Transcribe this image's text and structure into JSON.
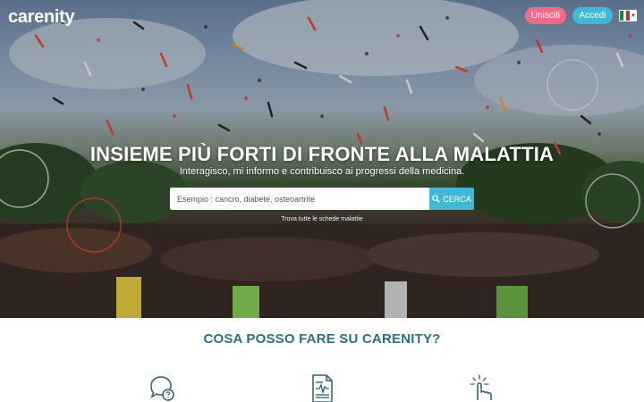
{
  "header": {
    "logo_text": "carenity",
    "join_label": "Unisciti",
    "login_label": "Accedi",
    "language_flag": "flag-it-icon"
  },
  "hero": {
    "headline": "INSIEME PIÙ FORTI DI FRONTE ALLA MALATTIA",
    "subline": "Interagisco, mi informo e contribuisco ai progressi della medicina.",
    "search_placeholder": "Esempio : cancro, diabete, osteoartrite",
    "search_button_label": "CERCA",
    "all_sheets_link": "Trova tutte le schede malattie"
  },
  "section": {
    "title": "COSA POSSO FARE SU CARENITY?",
    "features": [
      {
        "icon": "chat-question-icon"
      },
      {
        "icon": "document-chart-icon"
      },
      {
        "icon": "pointer-click-icon"
      }
    ]
  },
  "colors": {
    "join_button": "#f06b8a",
    "login_button": "#3fb9d6",
    "search_button": "#3fb9d6",
    "accent_teal": "#2b6f86",
    "icon_stroke": "#2b5f73"
  }
}
